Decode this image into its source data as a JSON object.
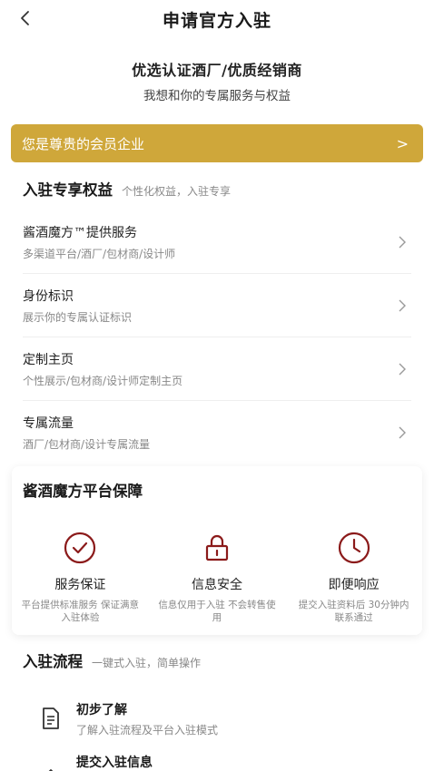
{
  "header": {
    "back_icon": "chevron-left-icon",
    "title": "申请官方入驻"
  },
  "hero": {
    "title": "优选认证酒厂/优质经销商",
    "subtitle": "我想和你的专属服务与权益"
  },
  "member_banner": {
    "text": "您是尊贵的会员企业",
    "arrow": ">",
    "color": "#cfa73a"
  },
  "benefits": {
    "title": "入驻专享权益",
    "subtitle": "个性化权益，入驻专享",
    "items": [
      {
        "name": "酱酒魔方™提供服务",
        "desc": "多渠道平台/酒厂/包材商/设计师"
      },
      {
        "name": "身份标识",
        "desc": "展示你的专属认证标识"
      },
      {
        "name": "定制主页",
        "desc": "个性展示/包材商/设计师定制主页"
      },
      {
        "name": "专属流量",
        "desc": "酒厂/包材商/设计专属流量"
      }
    ]
  },
  "guarantee": {
    "title": "酱酒魔方平台保障",
    "accent_color": "#8b1a1a",
    "items": [
      {
        "icon": "check-circle-icon",
        "label": "服务保证",
        "desc": "平台提供标准服务 保证满意入驻体验"
      },
      {
        "icon": "lock-icon",
        "label": "信息安全",
        "desc": "信息仅用于入驻 不会转售使用"
      },
      {
        "icon": "clock-icon",
        "label": "即便响应",
        "desc": "提交入驻资料后 30分钟内联系通过"
      }
    ]
  },
  "flow": {
    "title": "入驻流程",
    "subtitle": "一键式入驻，简单操作",
    "items": [
      {
        "icon": "document-icon",
        "name": "初步了解",
        "desc": "了解入驻流程及平台入驻模式"
      },
      {
        "icon": "upload-icon",
        "name": "提交入驻信息",
        "desc": ""
      }
    ]
  }
}
